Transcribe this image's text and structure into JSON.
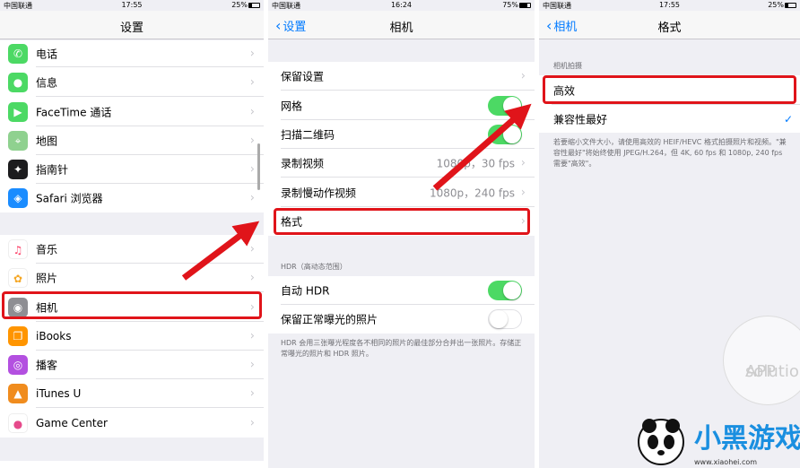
{
  "colors": {
    "accent": "#007aff",
    "toggle_on": "#4cd964",
    "highlight": "#e0141a"
  },
  "settings": {
    "status": {
      "carrier": "中国联通",
      "time": "17:55",
      "battery": "25%"
    },
    "title": "设置",
    "items": [
      {
        "label": "电话",
        "icon": "phone-icon"
      },
      {
        "label": "信息",
        "icon": "messages-icon"
      },
      {
        "label": "FaceTime 通话",
        "icon": "facetime-icon"
      },
      {
        "label": "地图",
        "icon": "maps-icon"
      },
      {
        "label": "指南针",
        "icon": "compass-icon"
      },
      {
        "label": "Safari 浏览器",
        "icon": "safari-icon"
      },
      {
        "label": "音乐",
        "icon": "music-icon"
      },
      {
        "label": "照片",
        "icon": "photos-icon"
      },
      {
        "label": "相机",
        "icon": "camera-icon"
      },
      {
        "label": "iBooks",
        "icon": "ibooks-icon"
      },
      {
        "label": "播客",
        "icon": "podcasts-icon"
      },
      {
        "label": "iTunes U",
        "icon": "itunes-u-icon"
      },
      {
        "label": "Game Center",
        "icon": "game-center-icon"
      }
    ]
  },
  "camera": {
    "status": {
      "carrier": "中国联通",
      "time": "16:24",
      "battery": "75%"
    },
    "back": "设置",
    "title": "相机",
    "items": [
      {
        "label": "保留设置"
      },
      {
        "label": "网格",
        "toggle": true
      },
      {
        "label": "扫描二维码",
        "toggle": true
      },
      {
        "label": "录制视频",
        "detail": "1080p，30 fps"
      },
      {
        "label": "录制慢动作视频",
        "detail": "1080p，240 fps"
      },
      {
        "label": "格式"
      }
    ],
    "hdr_header": "HDR（高动态范围）",
    "hdr_items": [
      {
        "label": "自动 HDR",
        "toggle": true
      },
      {
        "label": "保留正常曝光的照片",
        "toggle": false
      }
    ],
    "hdr_footnote": "HDR 会用三张曝光程度各不相同的照片的最佳部分合并出一张照片。存储正常曝光的照片和 HDR 照片。"
  },
  "format": {
    "status": {
      "carrier": "中国联通",
      "time": "17:55",
      "battery": "25%"
    },
    "back": "相机",
    "title": "格式",
    "section_header": "相机拍摄",
    "options": [
      {
        "label": "高效",
        "selected": false
      },
      {
        "label": "兼容性最好",
        "selected": true
      }
    ],
    "footnote": "若要缩小文件大小，请使用高效的 HEIF/HEVC 格式拍摄照片和视频。\"兼容性最好\"将始终使用 JPEG/H.264，但 4K, 60 fps 和 1080p, 240 fps 需要\"高效\"。"
  },
  "watermark": {
    "line1": "APP",
    "line2": "solution"
  },
  "logo": {
    "text": "小黑游戏",
    "url_text": "www.xiaohei.com"
  }
}
